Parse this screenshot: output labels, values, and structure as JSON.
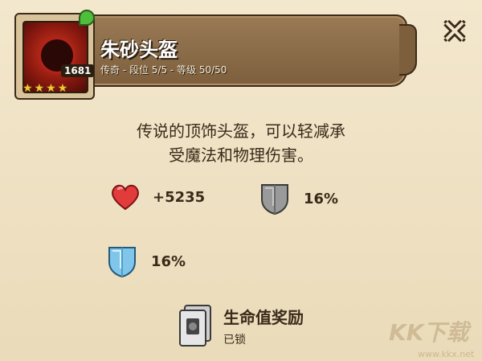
{
  "item": {
    "name": "朱砂头盔",
    "subtitle": "传奇 - 段位 5/5 - 等级 50/50",
    "level_badge": "1681",
    "stars": "★★★★"
  },
  "description": {
    "line1": "传说的顶饰头盔，可以轻减承",
    "line2": "受魔法和物理伤害。"
  },
  "stats": {
    "health": "+5235",
    "physical_armor": "16%",
    "magic_armor": "16%"
  },
  "reward": {
    "title": "生命值奖励",
    "status": "已锁"
  },
  "watermark": {
    "logo": "KK下载",
    "url": "www.kkx.net"
  },
  "colors": {
    "banner": "#8b6b47",
    "heart": "#e23b3b",
    "shield_gray": "#8f8f8f",
    "shield_blue": "#7fc6ea"
  }
}
